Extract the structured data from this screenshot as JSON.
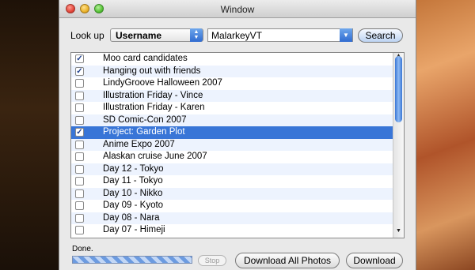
{
  "window": {
    "title": "Window"
  },
  "lookup": {
    "label": "Look up",
    "field": "Username",
    "value": "MalarkeyVT",
    "search_label": "Search"
  },
  "sets": [
    {
      "label": "Moo card candidates",
      "checked": true
    },
    {
      "label": "Hanging out with friends",
      "checked": true
    },
    {
      "label": "LindyGroove Halloween 2007",
      "checked": false
    },
    {
      "label": "Illustration Friday - Vince",
      "checked": false
    },
    {
      "label": "Illustration Friday - Karen",
      "checked": false
    },
    {
      "label": "SD Comic-Con 2007",
      "checked": false
    },
    {
      "label": "Project: Garden Plot",
      "checked": true,
      "selected": true
    },
    {
      "label": "Anime Expo 2007",
      "checked": false
    },
    {
      "label": "Alaskan cruise June 2007",
      "checked": false
    },
    {
      "label": "Day 12 - Tokyo",
      "checked": false
    },
    {
      "label": "Day 11 - Tokyo",
      "checked": false
    },
    {
      "label": "Day 10 - Nikko",
      "checked": false
    },
    {
      "label": "Day 09 - Kyoto",
      "checked": false
    },
    {
      "label": "Day 08 - Nara",
      "checked": false
    },
    {
      "label": "Day 07 - Himeji",
      "checked": false
    }
  ],
  "footer": {
    "status": "Done.",
    "stop_label": "Stop",
    "download_all_label": "Download All Photos",
    "download_label": "Download"
  },
  "colors": {
    "selection": "#3875d7",
    "row_alt": "#edf3fe"
  }
}
